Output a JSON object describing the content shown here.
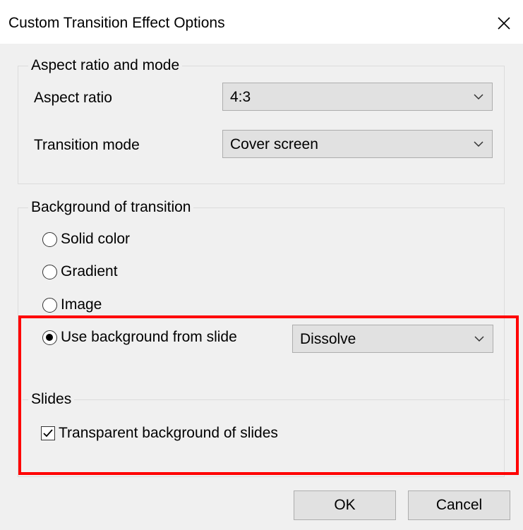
{
  "window": {
    "title": "Custom Transition Effect Options",
    "close_icon": "close-icon"
  },
  "aspect_group": {
    "legend": "Aspect ratio and mode",
    "aspect_ratio_label": "Aspect ratio",
    "aspect_ratio_value": "4:3",
    "transition_mode_label": "Transition mode",
    "transition_mode_value": "Cover screen"
  },
  "background_group": {
    "legend": "Background of transition",
    "options": [
      {
        "label": "Solid color",
        "checked": false
      },
      {
        "label": "Gradient",
        "checked": false
      },
      {
        "label": "Image",
        "checked": false
      },
      {
        "label": "Use background from slide",
        "checked": true
      }
    ],
    "slide_effect_value": "Dissolve"
  },
  "slides_group": {
    "legend": "Slides",
    "transparent_label": "Transparent background of slides",
    "transparent_checked": true
  },
  "buttons": {
    "ok": "OK",
    "cancel": "Cancel"
  },
  "colors": {
    "highlight": "#ff0000",
    "dialog_bg": "#f0f0f0"
  }
}
